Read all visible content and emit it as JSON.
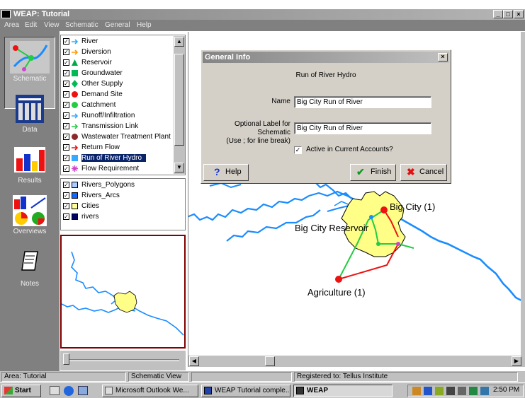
{
  "window": {
    "title": "WEAP: Tutorial",
    "controls": [
      "_",
      "□",
      "×"
    ]
  },
  "menu": [
    "Area",
    "Edit",
    "View",
    "Schematic",
    "General",
    "Help"
  ],
  "sidebar": [
    {
      "label": "Schematic",
      "icon": "schematic-icon",
      "selected": true
    },
    {
      "label": "Data",
      "icon": "data-icon",
      "selected": false
    },
    {
      "label": "Results",
      "icon": "results-icon",
      "selected": false
    },
    {
      "label": "Overviews",
      "icon": "overviews-icon",
      "selected": false
    },
    {
      "label": "Notes",
      "icon": "notes-icon",
      "selected": false
    }
  ],
  "legend": [
    {
      "label": "River",
      "symbol": "arrow",
      "color": "#33aaff",
      "checked": true
    },
    {
      "label": "Diversion",
      "symbol": "arrow",
      "color": "#ff9900",
      "checked": true
    },
    {
      "label": "Reservoir",
      "symbol": "triangle",
      "color": "#00aa44",
      "checked": true
    },
    {
      "label": "Groundwater",
      "symbol": "square",
      "color": "#00bb55",
      "checked": true
    },
    {
      "label": "Other Supply",
      "symbol": "diamond",
      "color": "#00bb55",
      "checked": true
    },
    {
      "label": "Demand Site",
      "symbol": "circle",
      "color": "#ee1111",
      "checked": true
    },
    {
      "label": "Catchment",
      "symbol": "circle",
      "color": "#22cc44",
      "checked": true
    },
    {
      "label": "Runoff/Infiltration",
      "symbol": "arrow",
      "color": "#33aaff",
      "checked": true
    },
    {
      "label": "Transmission Link",
      "symbol": "arrow",
      "color": "#22cc44",
      "checked": true
    },
    {
      "label": "Wastewater Treatment Plant",
      "symbol": "circle",
      "color": "#8b2a2a",
      "checked": true
    },
    {
      "label": "Return Flow",
      "symbol": "arrow",
      "color": "#ee1111",
      "checked": true
    },
    {
      "label": "Run of River Hydro",
      "symbol": "square",
      "color": "#33aaff",
      "checked": true,
      "selected": true
    },
    {
      "label": "Flow Requirement",
      "symbol": "star",
      "color": "#cc44cc",
      "checked": true
    }
  ],
  "layers": [
    {
      "label": "Rivers_Polygons",
      "color": "#aaccff",
      "checked": true
    },
    {
      "label": "Rivers_Arcs",
      "color": "#1166ff",
      "checked": true
    },
    {
      "label": "Cities",
      "color": "#ffff99",
      "checked": true
    },
    {
      "label": "rivers",
      "color": "#000066",
      "checked": true
    }
  ],
  "map": {
    "labels": {
      "big_city": "Big City (1)",
      "reservoir": "Big City Reservoir",
      "agriculture": "Agriculture (1)"
    },
    "river_color": "#1a8cff",
    "city_color": "#ffff88"
  },
  "dialog": {
    "title": "General Info",
    "heading": "Run of River Hydro",
    "name_label": "Name",
    "name_value": "Big City Run of River",
    "optional_label_line1": "Optional Label for Schematic",
    "optional_label_line2": "(Use ; for line break)",
    "optional_value": "Big City Run of River",
    "active_label": "Active in Current Accounts?",
    "active_checked": true,
    "help_button": "Help",
    "finish_button": "Finish",
    "cancel_button": "Cancel"
  },
  "status": {
    "area": "Area: Tutorial",
    "view": "Schematic View",
    "registered": "Registered to: Tellus Institute"
  },
  "taskbar": {
    "start": "Start",
    "tasks": [
      {
        "label": "Microsoft Outlook We...",
        "active": false
      },
      {
        "label": "WEAP Tutorial comple...",
        "active": false
      },
      {
        "label": "WEAP",
        "active": true
      }
    ],
    "clock": "2:50 PM"
  }
}
